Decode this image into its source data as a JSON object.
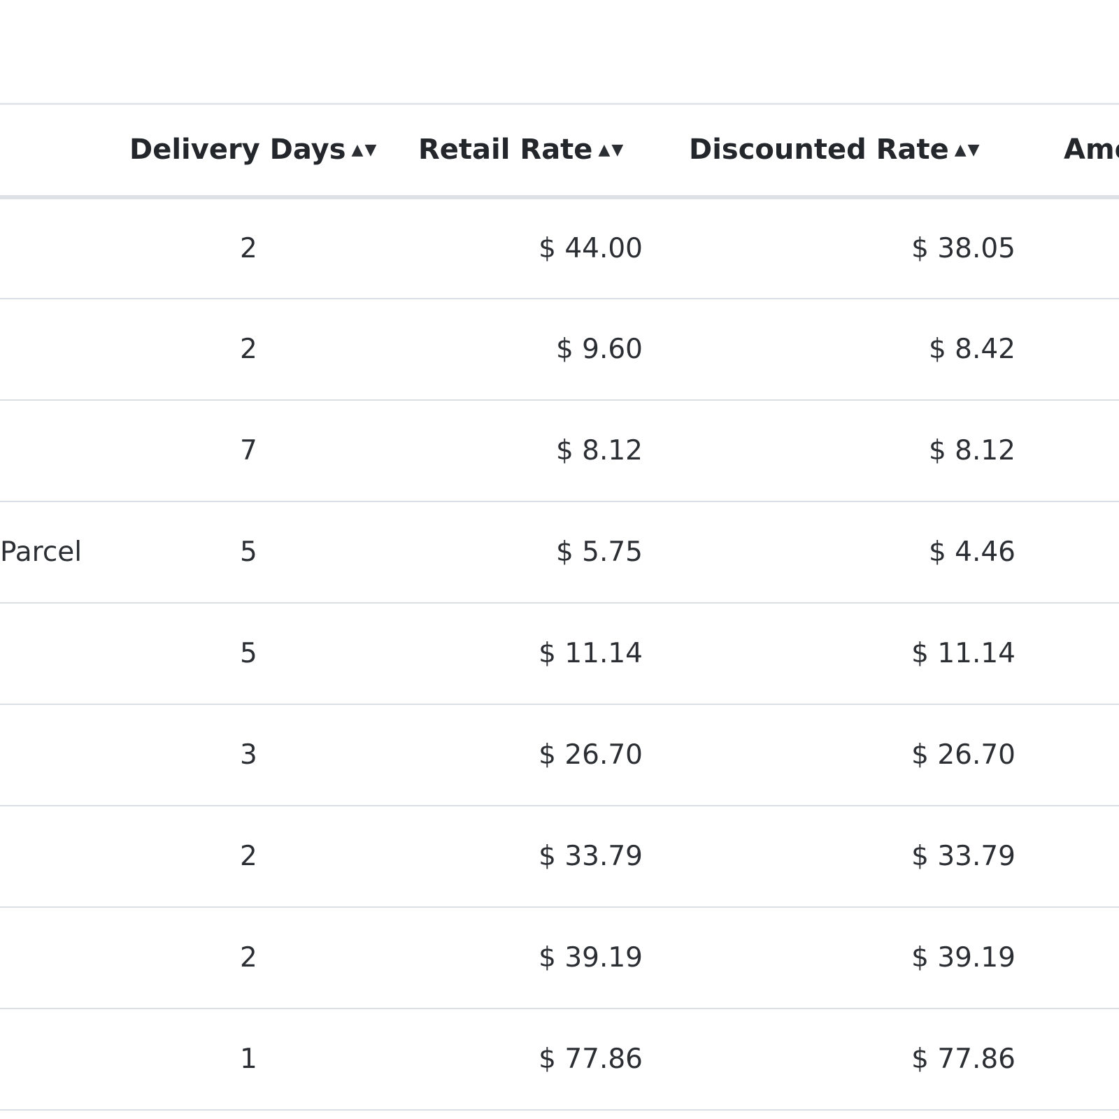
{
  "table": {
    "headers": {
      "delivery_days": "Delivery Days",
      "retail_rate": "Retail Rate",
      "discounted_rate": "Discounted Rate",
      "amount": "Amoun"
    },
    "sort_icon": "▲▼",
    "rows": [
      {
        "service": "",
        "delivery_days": "2",
        "retail_rate": "$ 44.00",
        "discounted_rate": "$ 38.05"
      },
      {
        "service": "",
        "delivery_days": "2",
        "retail_rate": "$ 9.60",
        "discounted_rate": "$ 8.42"
      },
      {
        "service": "",
        "delivery_days": "7",
        "retail_rate": "$ 8.12",
        "discounted_rate": "$ 8.12"
      },
      {
        "service": "Parcel",
        "delivery_days": "5",
        "retail_rate": "$ 5.75",
        "discounted_rate": "$ 4.46"
      },
      {
        "service": "",
        "delivery_days": "5",
        "retail_rate": "$ 11.14",
        "discounted_rate": "$ 11.14"
      },
      {
        "service": "",
        "delivery_days": "3",
        "retail_rate": "$ 26.70",
        "discounted_rate": "$ 26.70"
      },
      {
        "service": "",
        "delivery_days": "2",
        "retail_rate": "$ 33.79",
        "discounted_rate": "$ 33.79"
      },
      {
        "service": "",
        "delivery_days": "2",
        "retail_rate": "$ 39.19",
        "discounted_rate": "$ 39.19"
      },
      {
        "service": "",
        "delivery_days": "1",
        "retail_rate": "$ 77.86",
        "discounted_rate": "$ 77.86"
      }
    ]
  }
}
